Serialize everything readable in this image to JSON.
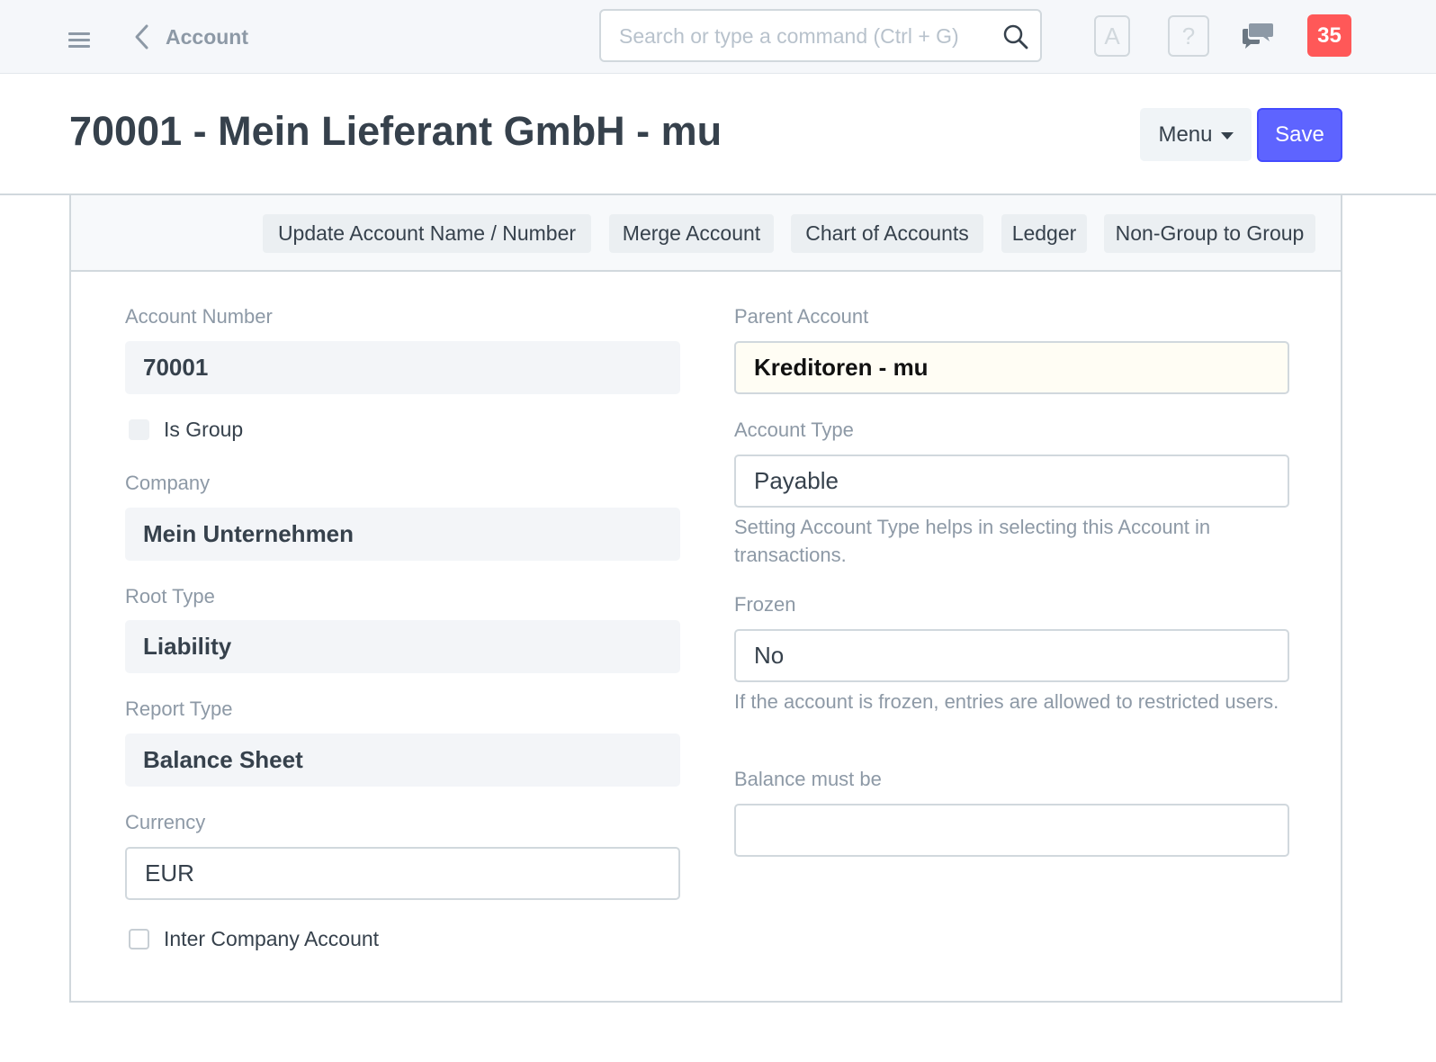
{
  "navbar": {
    "back_label": "Account",
    "search_placeholder": "Search or type a command (Ctrl + G)",
    "avatar_letter": "A",
    "help_glyph": "?",
    "notification_count": "35",
    "icons": [
      "hamburger-icon",
      "chevron-left-icon",
      "search-icon",
      "chat-icon"
    ]
  },
  "page": {
    "title": "70001 - Mein Lieferant GmbH - mu",
    "menu_label": "Menu",
    "save_label": "Save"
  },
  "toolbar": {
    "buttons": [
      "Update Account Name / Number",
      "Merge Account",
      "Chart of Accounts",
      "Ledger",
      "Non-Group to Group"
    ]
  },
  "form": {
    "account_number": {
      "label": "Account Number",
      "value": "70001"
    },
    "is_group": {
      "label": "Is Group",
      "checked": false
    },
    "company": {
      "label": "Company",
      "value": "Mein Unternehmen"
    },
    "root_type": {
      "label": "Root Type",
      "value": "Liability"
    },
    "report_type": {
      "label": "Report Type",
      "value": "Balance Sheet"
    },
    "currency": {
      "label": "Currency",
      "value": "EUR"
    },
    "inter_company": {
      "label": "Inter Company Account",
      "checked": false
    },
    "parent_account": {
      "label": "Parent Account",
      "value": "Kreditoren - mu"
    },
    "account_type": {
      "label": "Account Type",
      "value": "Payable",
      "help": "Setting Account Type helps in selecting this Account in transactions."
    },
    "frozen": {
      "label": "Frozen",
      "value": "No",
      "help": "If the account is frozen, entries are allowed to restricted users."
    },
    "balance_must_be": {
      "label": "Balance must be",
      "value": ""
    }
  },
  "colors": {
    "primary": "#5e64ff",
    "badge": "#ff5858",
    "muted_text": "#8d99a6",
    "text": "#36414c",
    "border": "#d1d8dd"
  }
}
